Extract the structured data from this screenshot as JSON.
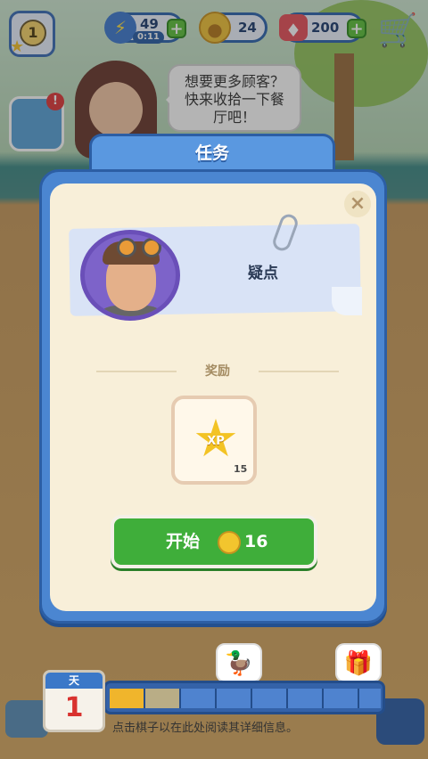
{
  "hud": {
    "level": "1",
    "energy": "49",
    "energy_timer": "0:11",
    "coins": "24",
    "gems": "200",
    "plus": "+"
  },
  "bubble": {
    "text": "想要更多顾客？快来收拾一下餐厅吧！"
  },
  "dialog": {
    "title": "任务",
    "close": "×",
    "task_name": "疑点",
    "rewards_label": "奖励",
    "reward": {
      "icon": "xp-star-icon",
      "xp_label": "XP",
      "amount": "15"
    },
    "start": {
      "label": "开始",
      "cost": "16"
    }
  },
  "bottom": {
    "day_label": "天",
    "day_number": "1",
    "hint": "点击棋子以在此处阅读其详细信息。",
    "milestones": [
      "duck-icon",
      "chest-icon"
    ],
    "progress_segments": 8,
    "progress_filled": 2
  },
  "colors": {
    "dialog_blue": "#4b86d1",
    "panel_cream": "#f8efd9",
    "start_green": "#3fae3a",
    "progress_gold": "#f0b52c"
  }
}
